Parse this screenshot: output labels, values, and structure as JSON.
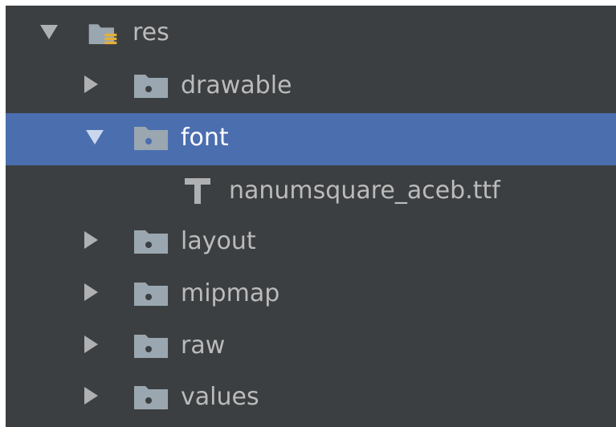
{
  "tree": {
    "root": {
      "label": "res",
      "icon": "resource-folder-icon",
      "expanded": true
    },
    "items": [
      {
        "label": "drawable",
        "icon": "folder-icon",
        "expanded": false
      },
      {
        "label": "font",
        "icon": "folder-icon",
        "expanded": true,
        "selected": true
      },
      {
        "label": "nanumsquare_aceb.ttf",
        "icon": "font-file-icon"
      },
      {
        "label": "layout",
        "icon": "folder-icon",
        "expanded": false
      },
      {
        "label": "mipmap",
        "icon": "folder-icon",
        "expanded": false
      },
      {
        "label": "raw",
        "icon": "folder-icon",
        "expanded": false
      },
      {
        "label": "values",
        "icon": "folder-icon",
        "expanded": false
      }
    ]
  },
  "colors": {
    "background": "#3c3f41",
    "selection": "#4b6eaf",
    "text": "#bbbbbb",
    "folder_icon": "#9aa7b0",
    "res_icon_accent": "#e5b03a"
  }
}
